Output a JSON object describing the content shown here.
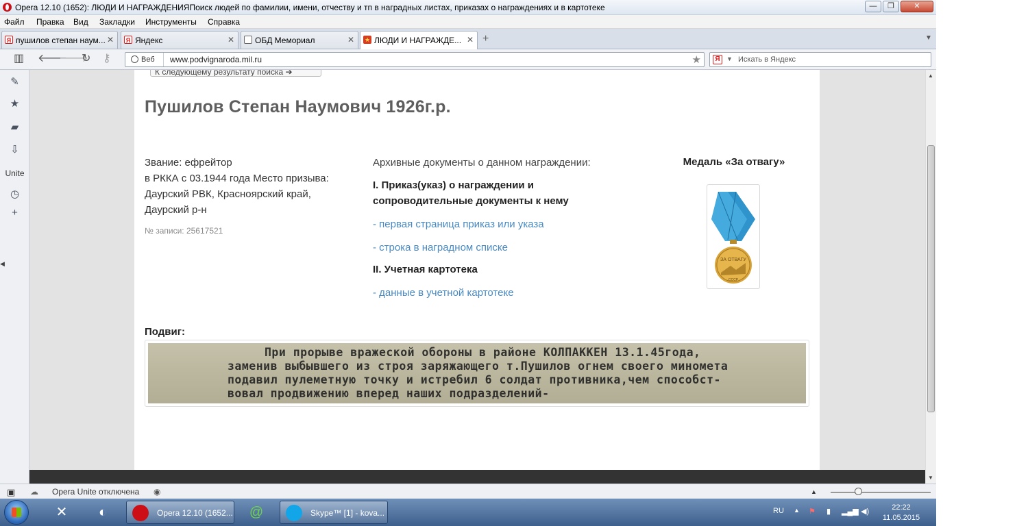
{
  "window": {
    "title": "Opera 12.10 (1652): ЛЮДИ И НАГРАЖДЕНИЯПоиск людей по фамилии, имени, отчеству и тп в наградных листах, приказах о награждениях и в картотеке",
    "min_glyph": "—",
    "max_glyph": "❐",
    "close_glyph": "✕"
  },
  "menu": [
    "Файл",
    "Правка",
    "Вид",
    "Закладки",
    "Инструменты",
    "Справка"
  ],
  "tabs": [
    {
      "label": "пушилов степан наум...",
      "icon": "yandex-icon",
      "active": false
    },
    {
      "label": "Яндекс",
      "icon": "yandex-icon",
      "active": false
    },
    {
      "label": "ОБД Мемориал",
      "icon": "document-icon",
      "active": false
    },
    {
      "label": "ЛЮДИ И НАГРАЖДЕ...",
      "icon": "medal-icon",
      "active": true
    }
  ],
  "tab_close_glyph": "✕",
  "newtab_glyph": "+",
  "address": {
    "mode_label": "Веб",
    "url": "www.podvignaroda.mil.ru",
    "search_placeholder": "Искать в Яндекс",
    "ya_letter": "Я"
  },
  "sidebar": {
    "unite_label": "Unite"
  },
  "page": {
    "next_result": "К следующему результату поиска ➔",
    "person_title": "Пушилов Степан Наумович 1926г.р.",
    "info_lines": [
      "Звание: ефрейтор",
      "в РККА с 03.1944 года Место призыва:",
      "Даурский РВК, Красноярский край,",
      "Даурский р-н"
    ],
    "record_number": "№ записи: 25617521",
    "archive_head": "Архивные документы о данном награждении:",
    "section1": "I. Приказ(указ) о награждении и сопроводительные документы к нему",
    "link1": "- первая страница приказ или указа",
    "link2": "- строка в наградном списке",
    "section2": "II. Учетная картотека",
    "link3": "- данные в учетной картотеке",
    "medal_title": "Медаль «За отвагу»",
    "medal_inscription": "ЗА ОТВАГУ",
    "medal_bottom": "СССР",
    "feat_label": "Подвиг:",
    "feat_lines": [
      "При прорыве вражеской обороны в районе КОЛПАККЕН 13.1.45года,",
      "заменив выбывшего из строя заряжающего т.Пушилов огнем своего миномета",
      "подавил пулеметную точку и истребил 6 солдат противника,чем способст-",
      "вовал продвижению вперед наших подразделений-"
    ]
  },
  "statusbar": {
    "unite_status": "Opera Unite отключена"
  },
  "taskbar": {
    "tasks": [
      {
        "label": "Opera 12.10 (1652...",
        "icon": "opera-icon"
      },
      {
        "label": "Skype™ [1] - kova...",
        "icon": "skype-icon"
      }
    ],
    "lang": "RU",
    "time": "22:22",
    "date": "11.05.2015"
  },
  "colors": {
    "link": "#4a8ac2",
    "opera_red": "#cc0f16",
    "ribbon": "#3fa4d8",
    "medal_gold": "#d9a43a"
  }
}
